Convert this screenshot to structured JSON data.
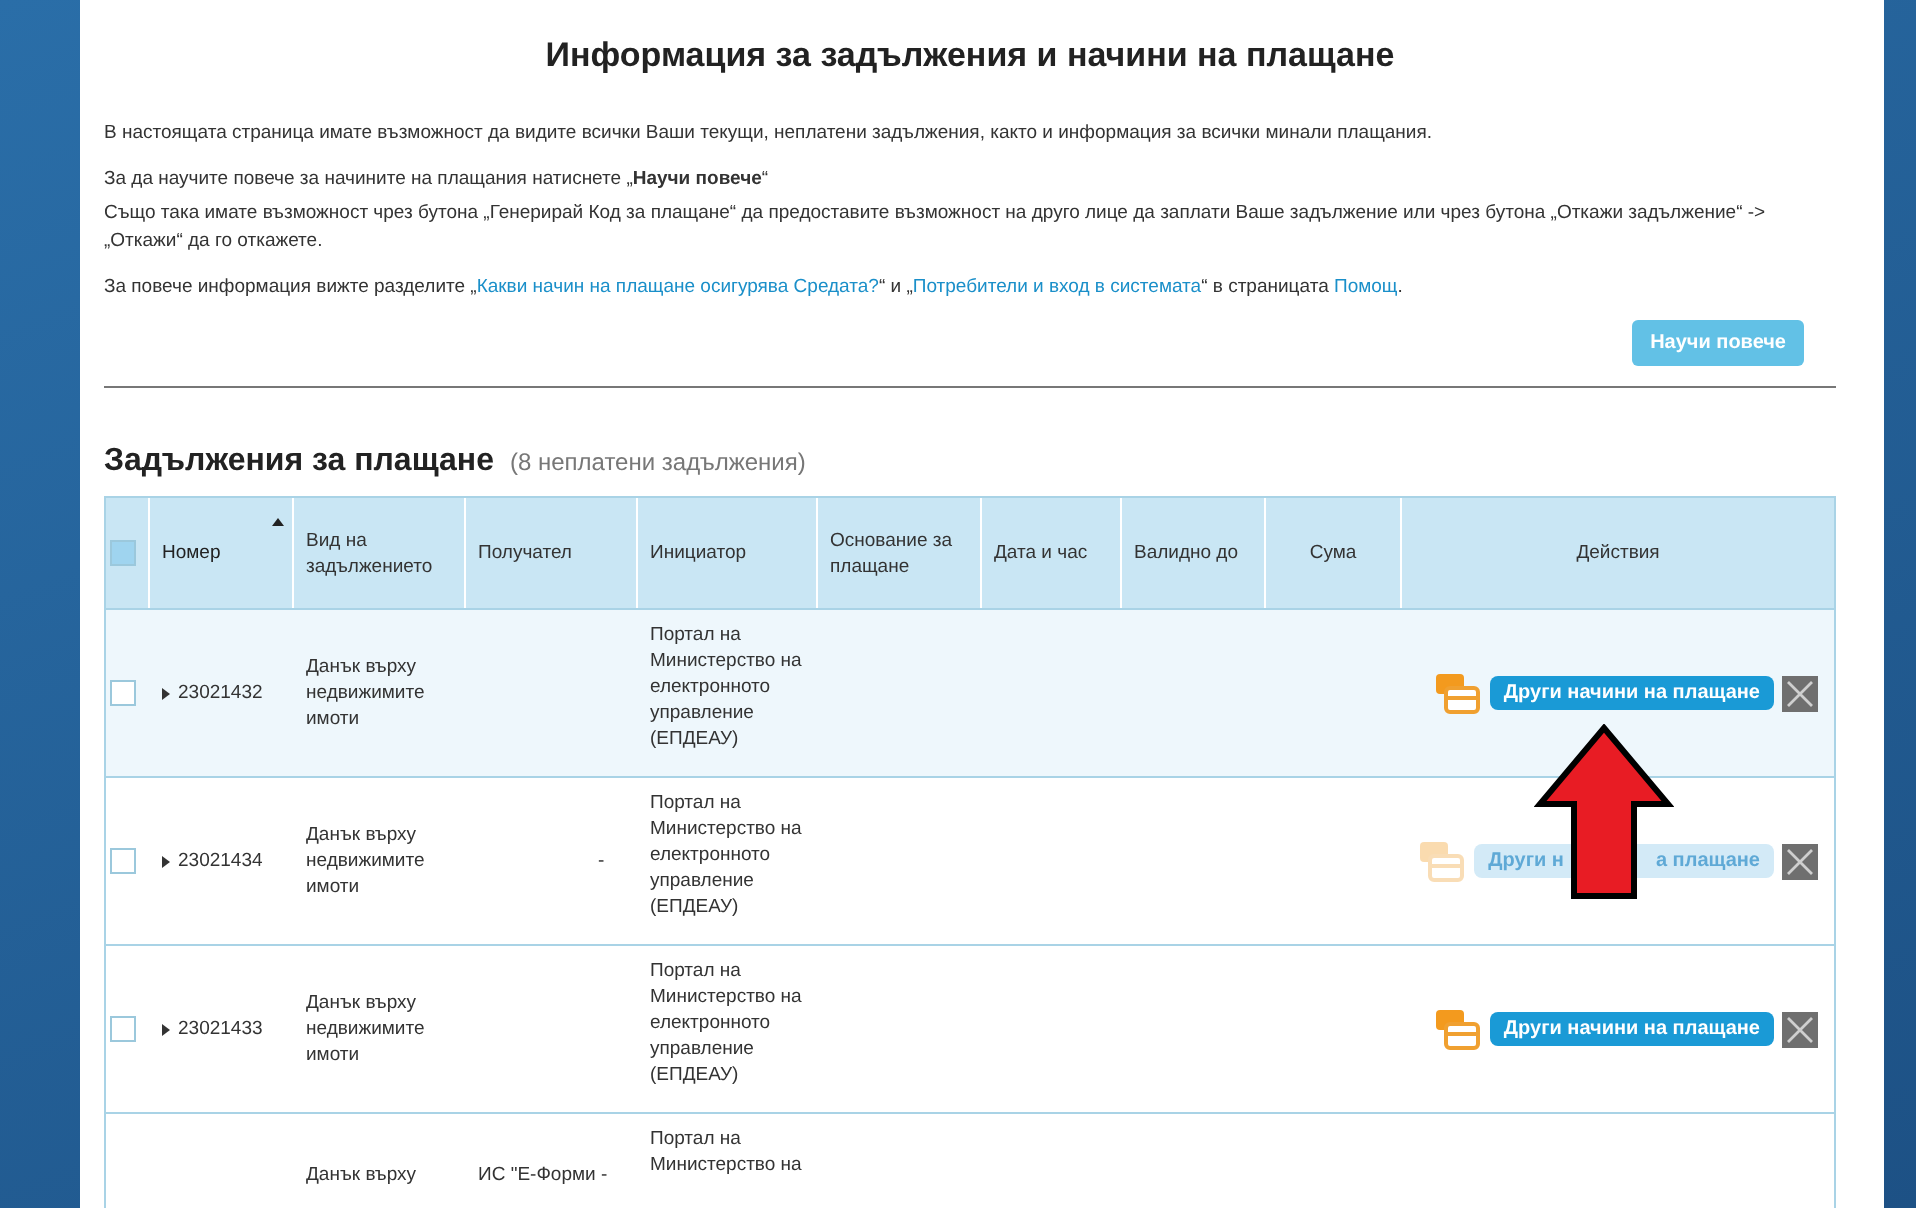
{
  "page": {
    "title": "Информация за задължения и начини на плащане",
    "intro": [
      "В настоящата страница имате възможност да видите всички Ваши текущи, неплатени задължения, както и информация за всички минали плащания.",
      "За да научите повече за начините на плащания натиснете „**Научи повече**“",
      "Също така имате възможност чрез бутона „Генерирай Код за плащане“ да предоставите възможност на друго лице да заплати Ваше задължение или чрез бутона „Откажи задължение“ -> „Откажи“ да го откажете."
    ],
    "info": [
      {
        "kind": "text",
        "text": "За повече информация вижте разделите „"
      },
      {
        "kind": "link",
        "text": "Какви начин на плащане осигурява Средата?"
      },
      {
        "kind": "text",
        "text": "“ и „"
      },
      {
        "kind": "link",
        "text": "Потребители и вход в системата"
      },
      {
        "kind": "text",
        "text": "“ в страницата "
      },
      {
        "kind": "link",
        "text": "Помощ"
      },
      {
        "kind": "text",
        "text": "."
      }
    ],
    "learn_more_button": "Научи повече"
  },
  "obligations": {
    "heading": "Задължения за плащане",
    "count": "(8 неплатени задължения)",
    "table": {
      "all_checked": true,
      "columns": [
        {
          "label": "Номер",
          "sorted": true
        },
        {
          "label": "Вид на задължението",
          "sorted": false
        },
        {
          "label": "Получател",
          "sorted": false
        },
        {
          "label": "Инициатор",
          "sorted": false
        },
        {
          "label": "Основание за плащане",
          "sorted": false
        },
        {
          "label": "Дата и час",
          "sorted": false
        },
        {
          "label": "Валидно до",
          "sorted": false
        },
        {
          "label": "Сума",
          "sorted": false
        },
        {
          "label": "Действия",
          "sorted": false
        }
      ],
      "rows": [
        {
          "kind": "full",
          "selected": true,
          "checked": false,
          "number": "23021432",
          "type": "Данък върху недвижимите имоти",
          "recipient": "",
          "initiator": "Портал на Министерство на електронното управление (ЕПДЕАУ)",
          "action": [
            "Други начини на плащане"
          ],
          "action_disabled": false
        },
        {
          "kind": "full",
          "selected": false,
          "checked": false,
          "number": "23021434",
          "type": "Данък върху недвижимите имоти",
          "recipient": "-",
          "initiator": "Портал на Министерство на електронното управление (ЕПДЕАУ)",
          "action": [
            "Други н",
            "а плащане"
          ],
          "action_disabled": true
        },
        {
          "kind": "full",
          "selected": false,
          "checked": false,
          "number": "23021433",
          "type": "Данък върху недвижимите имоти",
          "recipient": "",
          "initiator": "Портал на Министерство на електронното управление (ЕПДЕАУ)",
          "action": [
            "Други начини на плащане"
          ],
          "action_disabled": false
        },
        {
          "kind": "partial",
          "selected": false,
          "type": "Данък върху",
          "recipient": "ИС \"Е-Форми -",
          "initiator": "Портал на Министерство на"
        }
      ]
    }
  }
}
